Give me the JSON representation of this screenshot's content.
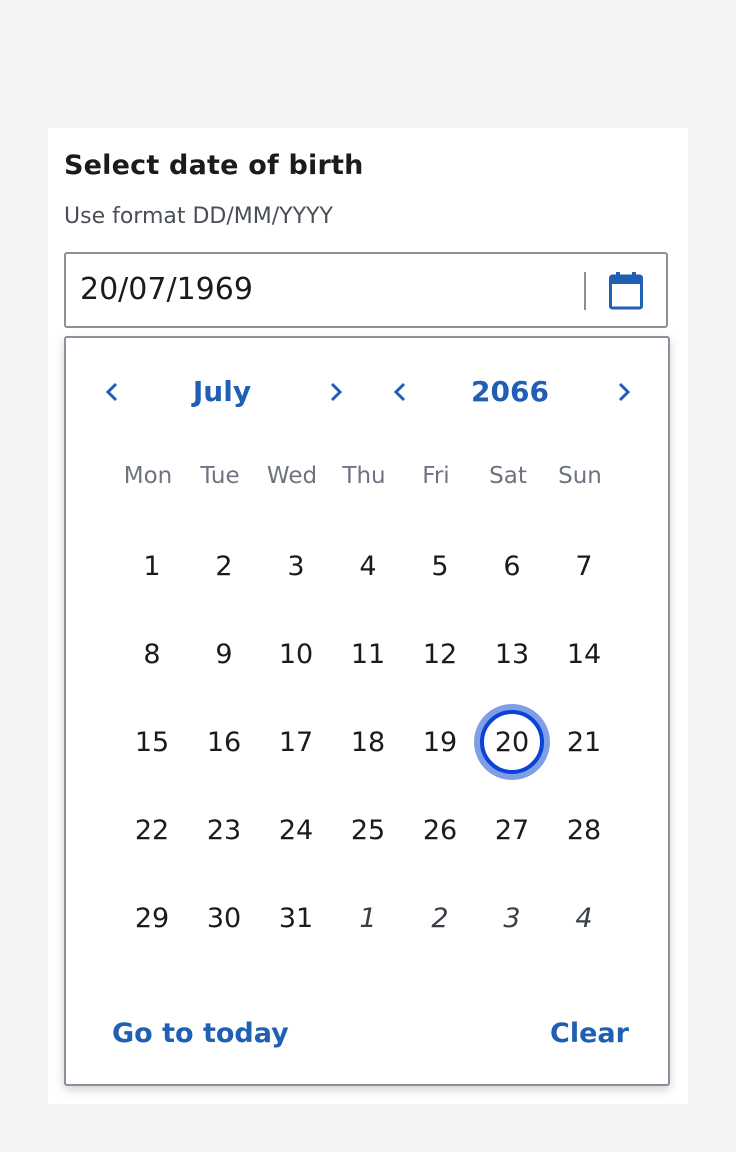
{
  "field": {
    "label": "Select date of birth",
    "hint": "Use format DD/MM/YYYY",
    "value": "20/07/1969"
  },
  "calendar": {
    "month": "July",
    "year": "2066",
    "weekdays": [
      "Mon",
      "Tue",
      "Wed",
      "Thu",
      "Fri",
      "Sat",
      "Sun"
    ],
    "selected_day": "20",
    "days": [
      {
        "label": "1",
        "current": true
      },
      {
        "label": "2",
        "current": true
      },
      {
        "label": "3",
        "current": true
      },
      {
        "label": "4",
        "current": true
      },
      {
        "label": "5",
        "current": true
      },
      {
        "label": "6",
        "current": true
      },
      {
        "label": "7",
        "current": true
      },
      {
        "label": "8",
        "current": true
      },
      {
        "label": "9",
        "current": true
      },
      {
        "label": "10",
        "current": true
      },
      {
        "label": "11",
        "current": true
      },
      {
        "label": "12",
        "current": true
      },
      {
        "label": "13",
        "current": true
      },
      {
        "label": "14",
        "current": true
      },
      {
        "label": "15",
        "current": true
      },
      {
        "label": "16",
        "current": true
      },
      {
        "label": "17",
        "current": true
      },
      {
        "label": "18",
        "current": true
      },
      {
        "label": "19",
        "current": true
      },
      {
        "label": "20",
        "current": true
      },
      {
        "label": "21",
        "current": true
      },
      {
        "label": "22",
        "current": true
      },
      {
        "label": "23",
        "current": true
      },
      {
        "label": "24",
        "current": true
      },
      {
        "label": "25",
        "current": true
      },
      {
        "label": "26",
        "current": true
      },
      {
        "label": "27",
        "current": true
      },
      {
        "label": "28",
        "current": true
      },
      {
        "label": "29",
        "current": true
      },
      {
        "label": "30",
        "current": true
      },
      {
        "label": "31",
        "current": true
      },
      {
        "label": "1",
        "current": false
      },
      {
        "label": "2",
        "current": false
      },
      {
        "label": "3",
        "current": false
      },
      {
        "label": "4",
        "current": false
      }
    ],
    "go_to_today_label": "Go to today",
    "clear_label": "Clear"
  },
  "icons": {
    "calendar": "calendar-icon",
    "prev": "chevron-left-icon",
    "next": "chevron-right-icon"
  },
  "colors": {
    "accent": "#1f5fb4",
    "selected_ring": "#0a43d6",
    "selected_halo": "#7f9ee5",
    "border": "#8a9099"
  }
}
